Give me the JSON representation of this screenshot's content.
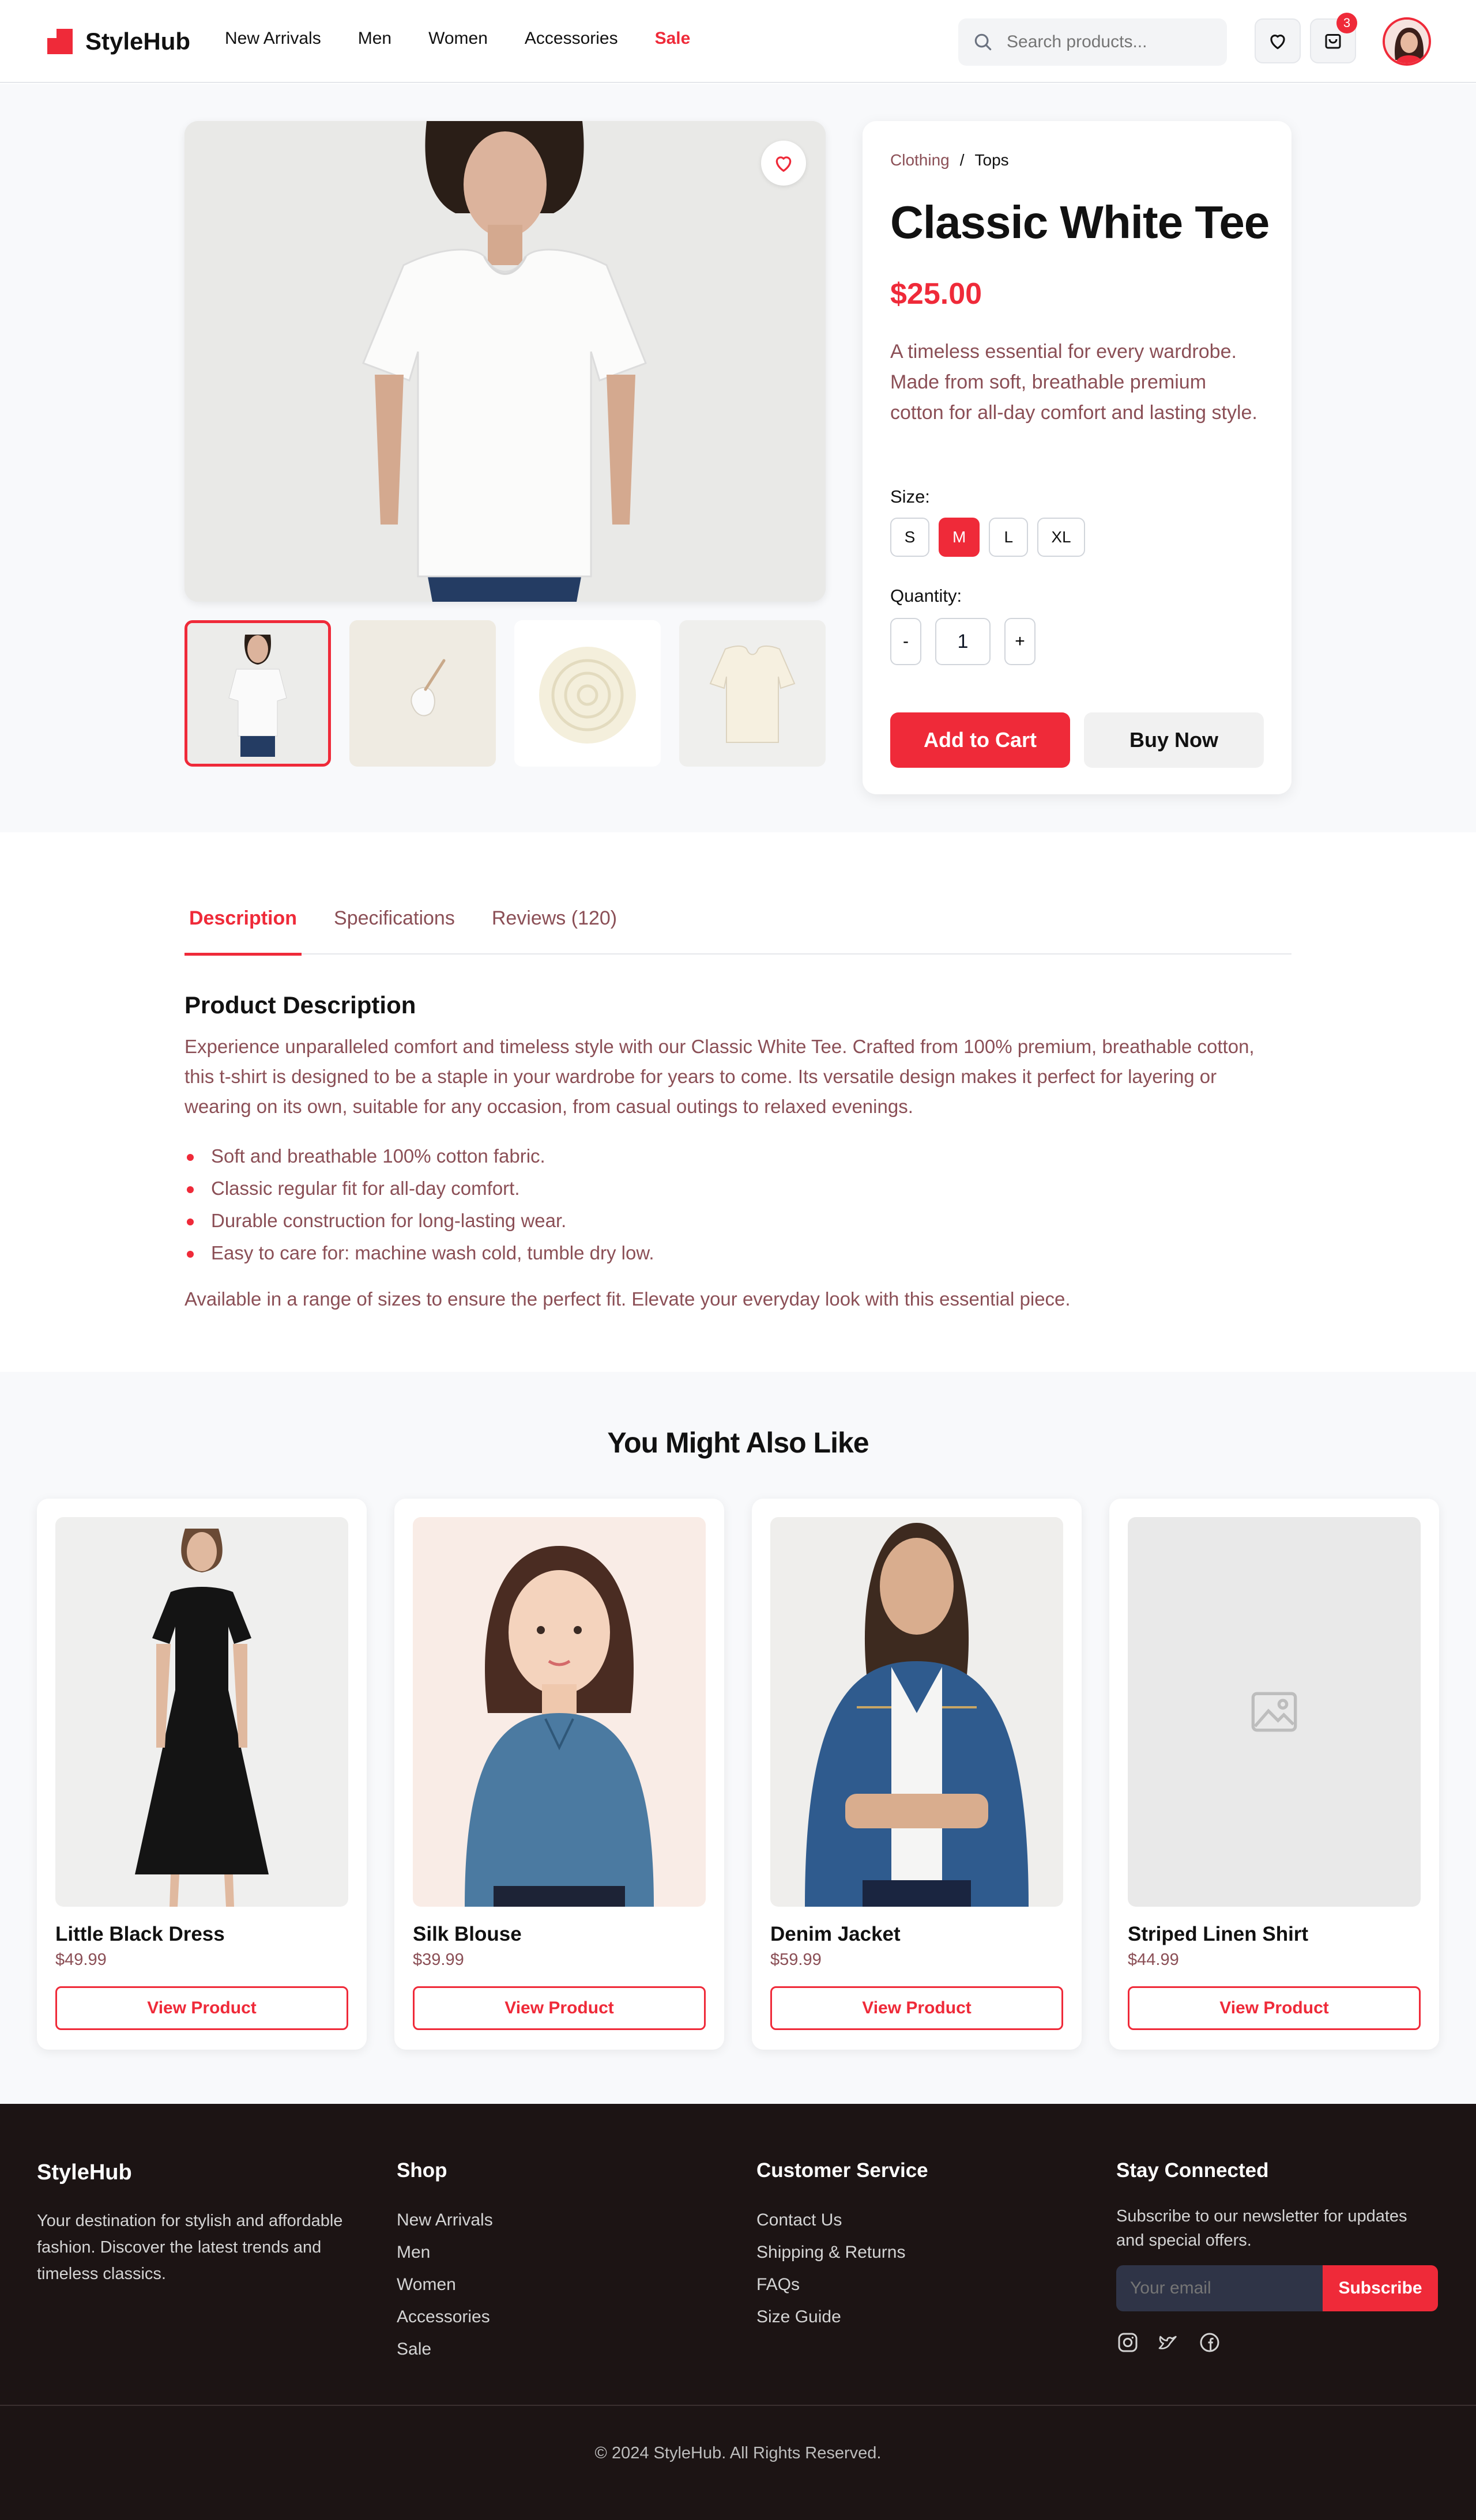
{
  "brand": {
    "name": "StyleHub",
    "accent": "#ef2a39"
  },
  "nav": {
    "items": [
      "New Arrivals",
      "Men",
      "Women",
      "Accessories"
    ],
    "sale": "Sale"
  },
  "search": {
    "placeholder": "Search products..."
  },
  "header": {
    "cart_count": "3",
    "icons": [
      "search-icon",
      "heart-icon",
      "shopping-bag-icon"
    ]
  },
  "product": {
    "breadcrumb": [
      "Clothing",
      "/",
      "Tops"
    ],
    "title": "Classic White Tee",
    "price": "$25.00",
    "short_description": "A timeless essential for every wardrobe. Made from soft, breathable premium cotton for all-day comfort and lasting style.",
    "size_label": "Size:",
    "sizes": [
      "S",
      "M",
      "L",
      "XL"
    ],
    "selected_size": "M",
    "quantity_label": "Quantity:",
    "quantity": "1",
    "qty_minus": "-",
    "qty_plus": "+",
    "add_to_cart": "Add to Cart",
    "buy_now": "Buy Now"
  },
  "tabs": [
    "Description",
    "Specifications",
    "Reviews (120)"
  ],
  "description": {
    "heading": "Product Description",
    "paragraph": "Experience unparalleled comfort and timeless style with our Classic White Tee. Crafted from 100% premium, breathable cotton, this t-shirt is designed to be a staple in your wardrobe for years to come. Its versatile design makes it perfect for layering or wearing on its own, suitable for any occasion, from casual outings to relaxed evenings.",
    "bullets": [
      "Soft and breathable 100% cotton fabric.",
      "Classic regular fit for all-day comfort.",
      "Durable construction for long-lasting wear.",
      "Easy to care for: machine wash cold, tumble dry low."
    ],
    "closing": "Available in a range of sizes to ensure the perfect fit. Elevate your everyday look with this essential piece."
  },
  "related": {
    "title": "You Might Also Like",
    "button": "View Product",
    "items": [
      {
        "name": "Little Black Dress",
        "price": "$49.99"
      },
      {
        "name": "Silk Blouse",
        "price": "$39.99"
      },
      {
        "name": "Denim Jacket",
        "price": "$59.99"
      },
      {
        "name": "Striped Linen Shirt",
        "price": "$44.99"
      }
    ]
  },
  "footer": {
    "brand": "StyleHub",
    "about": "Your destination for stylish and affordable fashion. Discover the latest trends and timeless classics.",
    "shop_title": "Shop",
    "shop_links": [
      "New Arrivals",
      "Men",
      "Women",
      "Accessories",
      "Sale"
    ],
    "service_title": "Customer Service",
    "service_links": [
      "Contact Us",
      "Shipping & Returns",
      "FAQs",
      "Size Guide"
    ],
    "connect_title": "Stay Connected",
    "newsletter": "Subscribe to our newsletter for updates and special offers.",
    "email_placeholder": "Your email",
    "subscribe": "Subscribe",
    "social_icons": [
      "instagram-icon",
      "twitter-icon",
      "facebook-icon"
    ],
    "copyright": "© 2024 StyleHub. All Rights Reserved."
  }
}
